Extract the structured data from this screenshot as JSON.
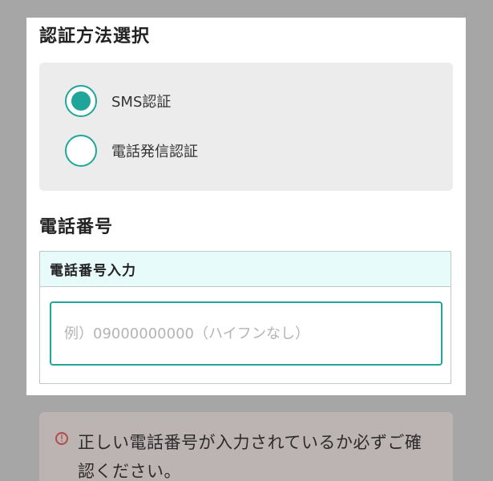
{
  "colors": {
    "accent": "#20a59a",
    "overlay": "#a6a6a6",
    "panel_bg": "#ffffff",
    "radio_box_bg": "#ececec",
    "input_header_bg": "#e8fbfb",
    "alert_icon": "#b24a4a"
  },
  "auth_section": {
    "title": "認証方法選択",
    "options": [
      {
        "label": "SMS認証",
        "selected": true
      },
      {
        "label": "電話発信認証",
        "selected": false
      }
    ]
  },
  "phone_section": {
    "title": "電話番号",
    "input_header": "電話番号入力",
    "input_placeholder": "例）09000000000（ハイフンなし）",
    "input_value": ""
  },
  "alert": {
    "icon": "exclamation-circle-icon",
    "icon_glyph": "!",
    "text": "正しい電話番号が入力されているか必ずご確認ください。"
  }
}
